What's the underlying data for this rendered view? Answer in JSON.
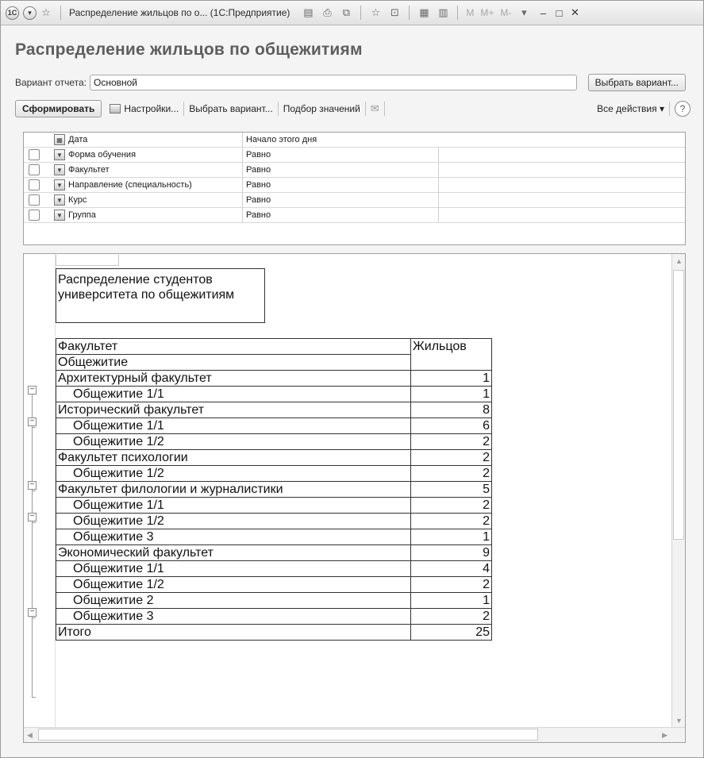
{
  "window": {
    "title": "Распределение жильцов по о... (1С:Предприятие)",
    "logo": "1С",
    "mem_buttons": [
      "M",
      "M+",
      "M-"
    ],
    "min_glyph": "–",
    "max_glyph": "□",
    "close_glyph": "✕"
  },
  "form": {
    "title": "Распределение жильцов по общежитиям",
    "variant_label": "Вариант отчета:",
    "variant_value": "Основной",
    "choose_variant_button": "Выбрать вариант..."
  },
  "toolbar": {
    "generate": "Сформировать",
    "settings": "Настройки...",
    "choose_variant": "Выбрать вариант...",
    "select_values": "Подбор значений",
    "all_actions": "Все действия ▾",
    "help": "?"
  },
  "settings": {
    "rows": [
      {
        "name": "Дата",
        "condition": "Начало этого дня"
      },
      {
        "name": "Форма обучения",
        "condition": "Равно"
      },
      {
        "name": "Факультет",
        "condition": "Равно"
      },
      {
        "name": "Направление (специальность)",
        "condition": "Равно"
      },
      {
        "name": "Курс",
        "condition": "Равно"
      },
      {
        "name": "Группа",
        "condition": "Равно"
      }
    ]
  },
  "report": {
    "title": "Распределение студентов университета по общежитиям",
    "header": {
      "faculty": "Факультет",
      "dorm": "Общежитие",
      "residents": "Жильцов"
    },
    "groups": [
      {
        "faculty": "Архитектурный факультет",
        "total": "1",
        "items": [
          {
            "dorm": "Общежитие 1/1",
            "count": "1"
          }
        ]
      },
      {
        "faculty": "Исторический факультет",
        "total": "8",
        "items": [
          {
            "dorm": "Общежитие 1/1",
            "count": "6"
          },
          {
            "dorm": "Общежитие 1/2",
            "count": "2"
          }
        ]
      },
      {
        "faculty": "Факультет психологии",
        "total": "2",
        "items": [
          {
            "dorm": "Общежитие 1/2",
            "count": "2"
          }
        ]
      },
      {
        "faculty": "Факультет филологии и журналистики",
        "total": "5",
        "items": [
          {
            "dorm": "Общежитие 1/1",
            "count": "2"
          },
          {
            "dorm": "Общежитие 1/2",
            "count": "2"
          },
          {
            "dorm": "Общежитие 3",
            "count": "1"
          }
        ]
      },
      {
        "faculty": "Экономический факультет",
        "total": "9",
        "items": [
          {
            "dorm": "Общежитие 1/1",
            "count": "4"
          },
          {
            "dorm": "Общежитие 1/2",
            "count": "2"
          },
          {
            "dorm": "Общежитие 2",
            "count": "1"
          },
          {
            "dorm": "Общежитие 3",
            "count": "2"
          }
        ]
      }
    ],
    "total_label": "Итого",
    "total_value": "25"
  }
}
